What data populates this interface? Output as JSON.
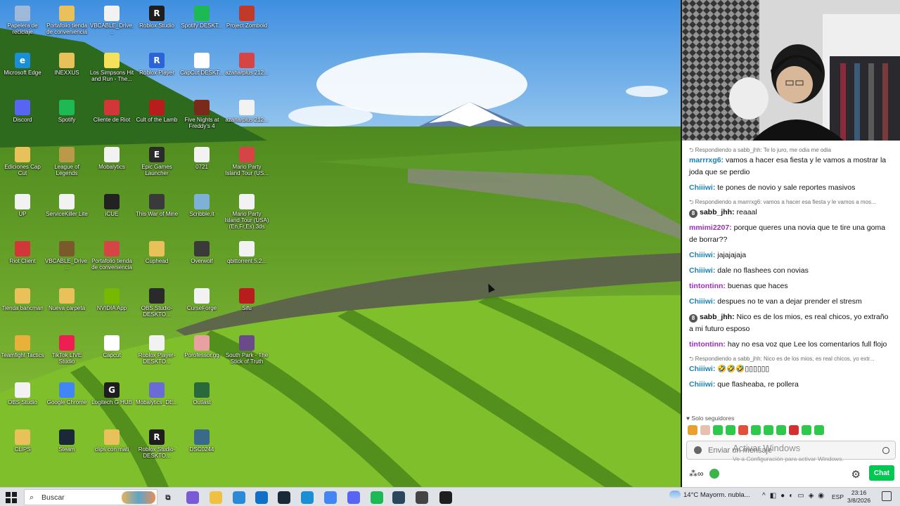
{
  "desktop": {
    "icons": [
      {
        "label": "Papelera de reciclaje",
        "color": "#9fb9d8",
        "glyph": "",
        "broken": false
      },
      {
        "label": "Portafolio tienda de conveniencia",
        "color": "#e8c15a",
        "glyph": "",
        "broken": true
      },
      {
        "label": "VBCABLE_Drive...",
        "color": "#f2f2f2",
        "glyph": "",
        "broken": true
      },
      {
        "label": "Roblox Studio",
        "color": "#1e1e1e",
        "glyph": "R",
        "broken": false
      },
      {
        "label": "Spotify DESKT...",
        "color": "#1db954",
        "glyph": "",
        "broken": false
      },
      {
        "label": "Project Zomboid",
        "color": "#c0392b",
        "glyph": "",
        "broken": true
      },
      {
        "label": "Microsoft Edge",
        "color": "#1a8fd6",
        "glyph": "e",
        "broken": false
      },
      {
        "label": "INEXXUS",
        "color": "#e8c15a",
        "glyph": "",
        "broken": true
      },
      {
        "label": "Los Simpsons Hit and Run - The...",
        "color": "#f5e25a",
        "glyph": "",
        "broken": true
      },
      {
        "label": "Roblox Player",
        "color": "#2b63d9",
        "glyph": "R",
        "broken": false
      },
      {
        "label": "CapCut DESKT...",
        "color": "#ffffff",
        "glyph": "",
        "broken": false
      },
      {
        "label": "azaharplus 212...",
        "color": "#d64545",
        "glyph": "",
        "broken": false
      },
      {
        "label": "Discord",
        "color": "#5865f2",
        "glyph": "",
        "broken": false
      },
      {
        "label": "Spotify",
        "color": "#1db954",
        "glyph": "",
        "broken": false
      },
      {
        "label": "Cliente de Riot",
        "color": "#d13639",
        "glyph": "",
        "broken": true
      },
      {
        "label": "Cult of the Lamb",
        "color": "#b81d1d",
        "glyph": "",
        "broken": false
      },
      {
        "label": "Five Nights at Freddy's 4",
        "color": "#7a2a1a",
        "glyph": "",
        "broken": true
      },
      {
        "label": "azaharplus 212...",
        "color": "#f2f2f2",
        "glyph": "",
        "broken": true
      },
      {
        "label": "Ediciones Cap Cut",
        "color": "#e8c15a",
        "glyph": "",
        "broken": true
      },
      {
        "label": "League of Legends",
        "color": "#b89a4a",
        "glyph": "",
        "broken": false
      },
      {
        "label": "Mobalytics",
        "color": "#f2f2f2",
        "glyph": "",
        "broken": true
      },
      {
        "label": "Epic Games Launcher",
        "color": "#2a2a2a",
        "glyph": "E",
        "broken": false
      },
      {
        "label": "0721",
        "color": "#f2f2f2",
        "glyph": "",
        "broken": true
      },
      {
        "label": "Mario Party Island Tour (US...",
        "color": "#d64545",
        "glyph": "",
        "broken": true
      },
      {
        "label": "UP",
        "color": "#f2f2f2",
        "glyph": "",
        "broken": true
      },
      {
        "label": "ServiceKiller Lite",
        "color": "#f2f2f2",
        "glyph": "",
        "broken": true
      },
      {
        "label": "iCUE",
        "color": "#222222",
        "glyph": "",
        "broken": true
      },
      {
        "label": "This War of Mine",
        "color": "#3a3a3a",
        "glyph": "",
        "broken": true
      },
      {
        "label": "Scribble.it",
        "color": "#7fb0d6",
        "glyph": "",
        "broken": true
      },
      {
        "label": "Mario Party Island Tour (USA) (En,Fr,Es).3ds",
        "color": "#f2f2f2",
        "glyph": "",
        "broken": false
      },
      {
        "label": "Riot Client",
        "color": "#d13639",
        "glyph": "",
        "broken": true
      },
      {
        "label": "VBCABLE_Drive...",
        "color": "#7a5a2a",
        "glyph": "",
        "broken": true
      },
      {
        "label": "Portafolio tienda de conveniencia",
        "color": "#d64545",
        "glyph": "",
        "broken": true
      },
      {
        "label": "Cuphead",
        "color": "#e8c15a",
        "glyph": "",
        "broken": false
      },
      {
        "label": "Overwolf",
        "color": "#3a3a3a",
        "glyph": "",
        "broken": false
      },
      {
        "label": "qbittorrent 5.2...",
        "color": "#f2f2f2",
        "glyph": "",
        "broken": true
      },
      {
        "label": "Tienda bancman",
        "color": "#e8c15a",
        "glyph": "",
        "broken": true
      },
      {
        "label": "Nueva carpeta",
        "color": "#e8c15a",
        "glyph": "",
        "broken": true
      },
      {
        "label": "NVIDIA App",
        "color": "#76b900",
        "glyph": "",
        "broken": true
      },
      {
        "label": "OBS Studio-DESKTO...",
        "color": "#2a2a2a",
        "glyph": "",
        "broken": true
      },
      {
        "label": "CurseForge",
        "color": "#f2f2f2",
        "glyph": "",
        "broken": true
      },
      {
        "label": "Sifu",
        "color": "#b81d1d",
        "glyph": "",
        "broken": false
      },
      {
        "label": "Teamfight Tactics",
        "color": "#e8b13a",
        "glyph": "",
        "broken": false
      },
      {
        "label": "TikTok LIVE Studio",
        "color": "#ee1d52",
        "glyph": "",
        "broken": false
      },
      {
        "label": "Capcut",
        "color": "#ffffff",
        "glyph": "",
        "broken": true
      },
      {
        "label": "Roblox Player-DESKTO...",
        "color": "#f2f2f2",
        "glyph": "",
        "broken": true
      },
      {
        "label": "Porofessor.gg",
        "color": "#e8a0a0",
        "glyph": "",
        "broken": true
      },
      {
        "label": "South Park - The Stick of Truth",
        "color": "#6b4a8a",
        "glyph": "",
        "broken": true
      },
      {
        "label": "OBS Studio",
        "color": "#f2f2f2",
        "glyph": "",
        "broken": true
      },
      {
        "label": "Google Chrome",
        "color": "#4285f4",
        "glyph": "",
        "broken": false
      },
      {
        "label": "Logitech G HUB",
        "color": "#1e1e1e",
        "glyph": "G",
        "broken": false
      },
      {
        "label": "Mobalytics_DE...",
        "color": "#6b6bd6",
        "glyph": "",
        "broken": true
      },
      {
        "label": "Outlast",
        "color": "#2a6a3a",
        "glyph": "",
        "broken": true
      },
      {
        "label": "CLIPS",
        "color": "#e8c15a",
        "glyph": "",
        "broken": true
      },
      {
        "label": "Steam",
        "color": "#1b2838",
        "glyph": "",
        "broken": false
      },
      {
        "label": "clips con mati",
        "color": "#e8c15a",
        "glyph": "",
        "broken": true
      },
      {
        "label": "Roblox Studio-DESKTO...",
        "color": "#1e1e1e",
        "glyph": "R",
        "broken": true
      },
      {
        "label": "DSC0244",
        "color": "#3a6a8a",
        "glyph": "",
        "broken": true
      }
    ]
  },
  "chat": {
    "items": [
      {
        "reply": "Respondiendo a sabb_jhh: Te lo juro, me odia me odia",
        "user": "marrrxg6",
        "color": "#1a7fb8",
        "badge": false,
        "text": "vamos a hacer esa fiesta y le vamos a mostrar la joda que se perdio"
      },
      {
        "reply": "",
        "user": "Chiiiwi",
        "color": "#1a7fb8",
        "badge": false,
        "text": "te pones de novio y sale reportes masivos"
      },
      {
        "reply": "Respondiendo a marrrxg6: vamos a hacer esa fiesta y le vamos a mos...",
        "user": "sabb_jhh",
        "color": "#111111",
        "badge": true,
        "text": "reaaal"
      },
      {
        "reply": "",
        "user": "mmimi2207",
        "color": "#9b2fb8",
        "badge": false,
        "text": "porque queres una novia que te tire una goma de borrar??"
      },
      {
        "reply": "",
        "user": "Chiiiwi",
        "color": "#1a7fb8",
        "badge": false,
        "text": "jajajajaja"
      },
      {
        "reply": "",
        "user": "Chiiiwi",
        "color": "#1a7fb8",
        "badge": false,
        "text": "dale no flashees con novias"
      },
      {
        "reply": "",
        "user": "tintontinn",
        "color": "#9b2fb8",
        "badge": false,
        "text": "buenas que haces"
      },
      {
        "reply": "",
        "user": "Chiiiwi",
        "color": "#1a7fb8",
        "badge": false,
        "text": "despues no te van a dejar prender el stresm"
      },
      {
        "reply": "",
        "user": "sabb_jhh",
        "color": "#111111",
        "badge": true,
        "text": "Nico es de los mios, es real chicos, yo extraño a mi futuro esposo"
      },
      {
        "reply": "",
        "user": "tintontinn",
        "color": "#9b2fb8",
        "badge": false,
        "text": "hay no esa voz que Lee los comentarios full flojo"
      },
      {
        "reply": "Respondiendo a sabb_jhh: Nico es de los mios, es real chicos, yo extr...",
        "user": "Chiiiwi",
        "color": "#1a7fb8",
        "badge": false,
        "text": "🤣🤣🤣▯▯▯▯▯▯"
      },
      {
        "reply": "",
        "user": "Chiiiwi",
        "color": "#1a7fb8",
        "badge": false,
        "text": "que flasheaba, re pollera"
      }
    ],
    "badge_glyph": "8",
    "followers_only": "Solo seguidores",
    "input_placeholder": "Enviar un mensaje",
    "chat_button": "Chat",
    "emote_colors": [
      "#e8a030",
      "#e8c0b0",
      "#2cc94a",
      "#2cc94a",
      "#e0503a",
      "#2cc94a",
      "#2cc94a",
      "#2cc94a",
      "#d43030",
      "#2cc94a",
      "#2cc94a"
    ]
  },
  "activation": {
    "title": "Activar Windows",
    "subtitle": "Ve a Configuración para activar Windows."
  },
  "taskbar": {
    "search_placeholder": "Buscar",
    "apps": [
      {
        "name": "task-view",
        "color": "#dfe3e8",
        "glyph": "⧉",
        "active": false
      },
      {
        "name": "copilot",
        "color": "#7a5ad6",
        "glyph": "",
        "active": false
      },
      {
        "name": "file-explorer",
        "color": "#f0c040",
        "glyph": "",
        "active": false
      },
      {
        "name": "store",
        "color": "#2b8ad6",
        "glyph": "",
        "active": false
      },
      {
        "name": "outlook",
        "color": "#1070c8",
        "glyph": "",
        "active": false
      },
      {
        "name": "steam",
        "color": "#1b2838",
        "glyph": "",
        "active": false
      },
      {
        "name": "edge",
        "color": "#1a8fd6",
        "glyph": "",
        "active": false
      },
      {
        "name": "chrome",
        "color": "#4285f4",
        "glyph": "",
        "active": true
      },
      {
        "name": "discord",
        "color": "#5865f2",
        "glyph": "",
        "active": true
      },
      {
        "name": "spotify",
        "color": "#1db954",
        "glyph": "",
        "active": true
      },
      {
        "name": "steam-app",
        "color": "#2a475e",
        "glyph": "",
        "active": true
      },
      {
        "name": "tool",
        "color": "#444444",
        "glyph": "",
        "active": true
      },
      {
        "name": "obs",
        "color": "#1e1e1e",
        "glyph": "",
        "active": true
      }
    ],
    "weather_text": "14°C  Mayorm. nubla...",
    "tray_glyphs": [
      "^",
      "◧",
      "●",
      "◐",
      "▭",
      "◈",
      "◉"
    ],
    "lang": "ESP",
    "time": "23:16",
    "date": "3/8/2026"
  }
}
